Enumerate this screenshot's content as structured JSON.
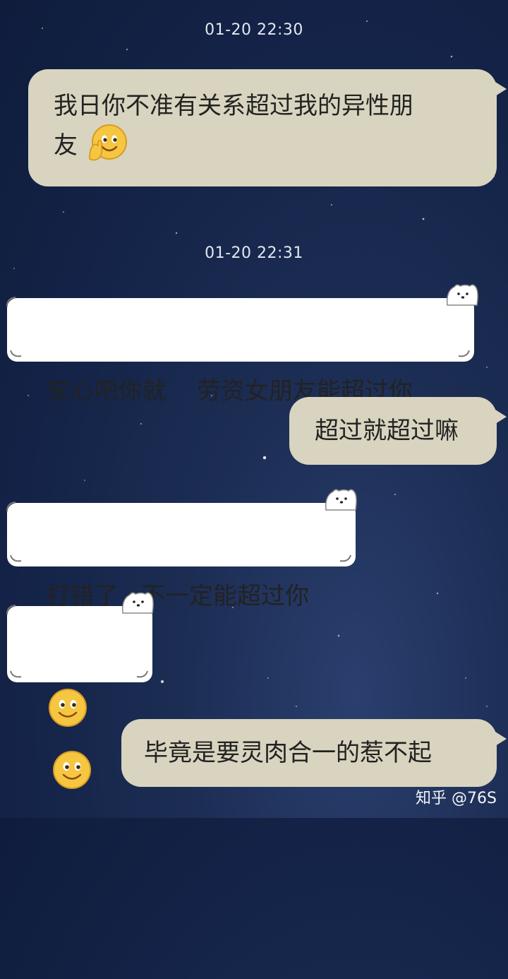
{
  "chat": {
    "timestamps": [
      "01-20 22:30",
      "01-20 22:31"
    ],
    "messages": [
      {
        "side": "sent",
        "text_line1": "我日你不准有关系超过我的异性朋",
        "text_line2": "友",
        "emoji": "face-palm-smile"
      },
      {
        "side": "received",
        "text": "安心吧你就    劳资女朋友能超过你"
      },
      {
        "side": "sent",
        "text": "超过就超过嘛"
      },
      {
        "side": "received",
        "text": "打错了   不一定能超过你"
      },
      {
        "side": "received",
        "emoji": [
          "smile",
          "smile"
        ]
      },
      {
        "side": "sent",
        "text": "毕竟是要灵肉合一的惹不起"
      }
    ]
  },
  "watermark": "知乎 @76S",
  "colors": {
    "sent_bubble": "#d8d4bf",
    "received_bubble": "#ffffff",
    "background": "#132246"
  }
}
